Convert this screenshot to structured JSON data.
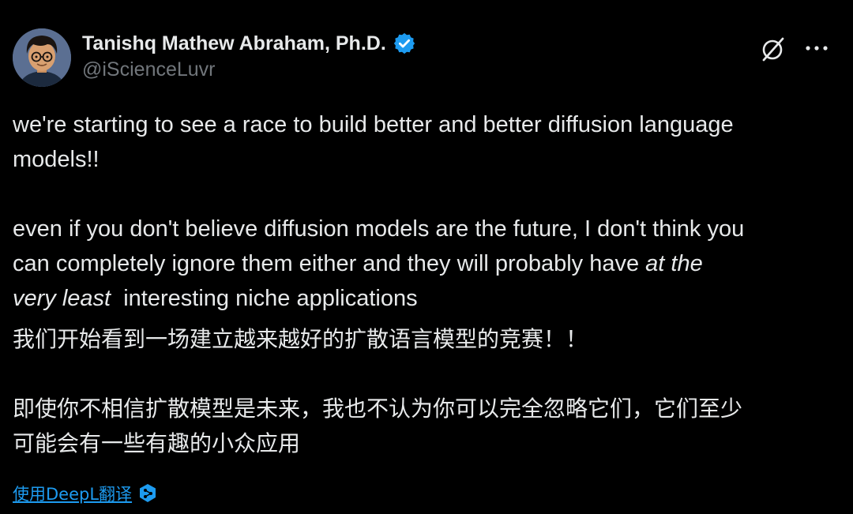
{
  "author": {
    "display_name": "Tanishq Mathew Abraham, Ph.D.",
    "handle": "@iScienceLuvr",
    "avatar_icon": "cartoon-avatar-with-glasses",
    "verified_icon": "verified-badge-icon"
  },
  "tweet": {
    "paragraph_1_line_1": "we're starting to see a race to build better and better diffusion language",
    "paragraph_1_line_2": "models!!",
    "paragraph_2_line_1": "even if you don't believe diffusion models are the future, I don't think you",
    "paragraph_2_line_2_start": "can completely ignore them either and they will probably have ",
    "paragraph_2_line_2_italic": "at the",
    "paragraph_2_line_3_italic": "very least",
    "paragraph_2_line_3_end": "  interesting niche applications"
  },
  "translation": {
    "line_1": "我们开始看到一场建立越来越好的扩散语言模型的竞赛！！",
    "line_2": "即使你不相信扩散模型是未来，我也不认为你可以完全忽略它们，它们至少",
    "line_3": "可能会有一些有趣的小众应用"
  },
  "actions": {
    "translate_label": "使用DeepL翻译",
    "grok_icon": "grok-icon",
    "more_icon": "more-options-icon"
  },
  "colors": {
    "background": "#000000",
    "text_primary": "#e7e9ea",
    "text_secondary": "#71767b",
    "accent": "#1d9bf0"
  }
}
